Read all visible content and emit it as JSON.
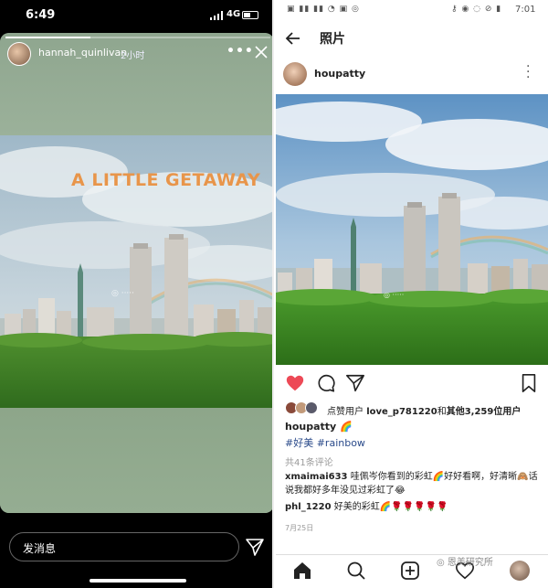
{
  "left": {
    "status": {
      "time": "6:49",
      "network": "4G"
    },
    "story": {
      "username": "hannah_quinlivan",
      "age": "2小时",
      "more": "•••",
      "caption": "A LITTLE GETAWAY",
      "progress_fraction": 0.32
    },
    "message_placeholder": "发消息",
    "icons": [
      "close-icon",
      "send-icon",
      "more-icon"
    ]
  },
  "right": {
    "status": {
      "time": "7:01"
    },
    "header_title": "照片",
    "post": {
      "username": "houpatty",
      "likes": {
        "prefix": "点赞用户",
        "user": "love_p781220",
        "middle": "和",
        "others": "其他3,259位用户"
      },
      "caption_user": "houpatty 🌈",
      "hashtags": "#好美 #rainbow",
      "comments_count": "共41条评论",
      "comments": [
        {
          "user": "xmaimai633",
          "text": "哇佩岑你看到的彩虹🌈好好看啊，好清晰🙈话说我都好多年没见过彩虹了😂"
        },
        {
          "user": "phl_1220",
          "text": "好美的彩虹🌈🌹🌹🌹🌹🌹"
        }
      ],
      "date": "7月25日",
      "liked": true
    },
    "watermark": "恩美研究所",
    "colors": {
      "heart": "#ed4956",
      "link": "#2a4a8a"
    }
  }
}
